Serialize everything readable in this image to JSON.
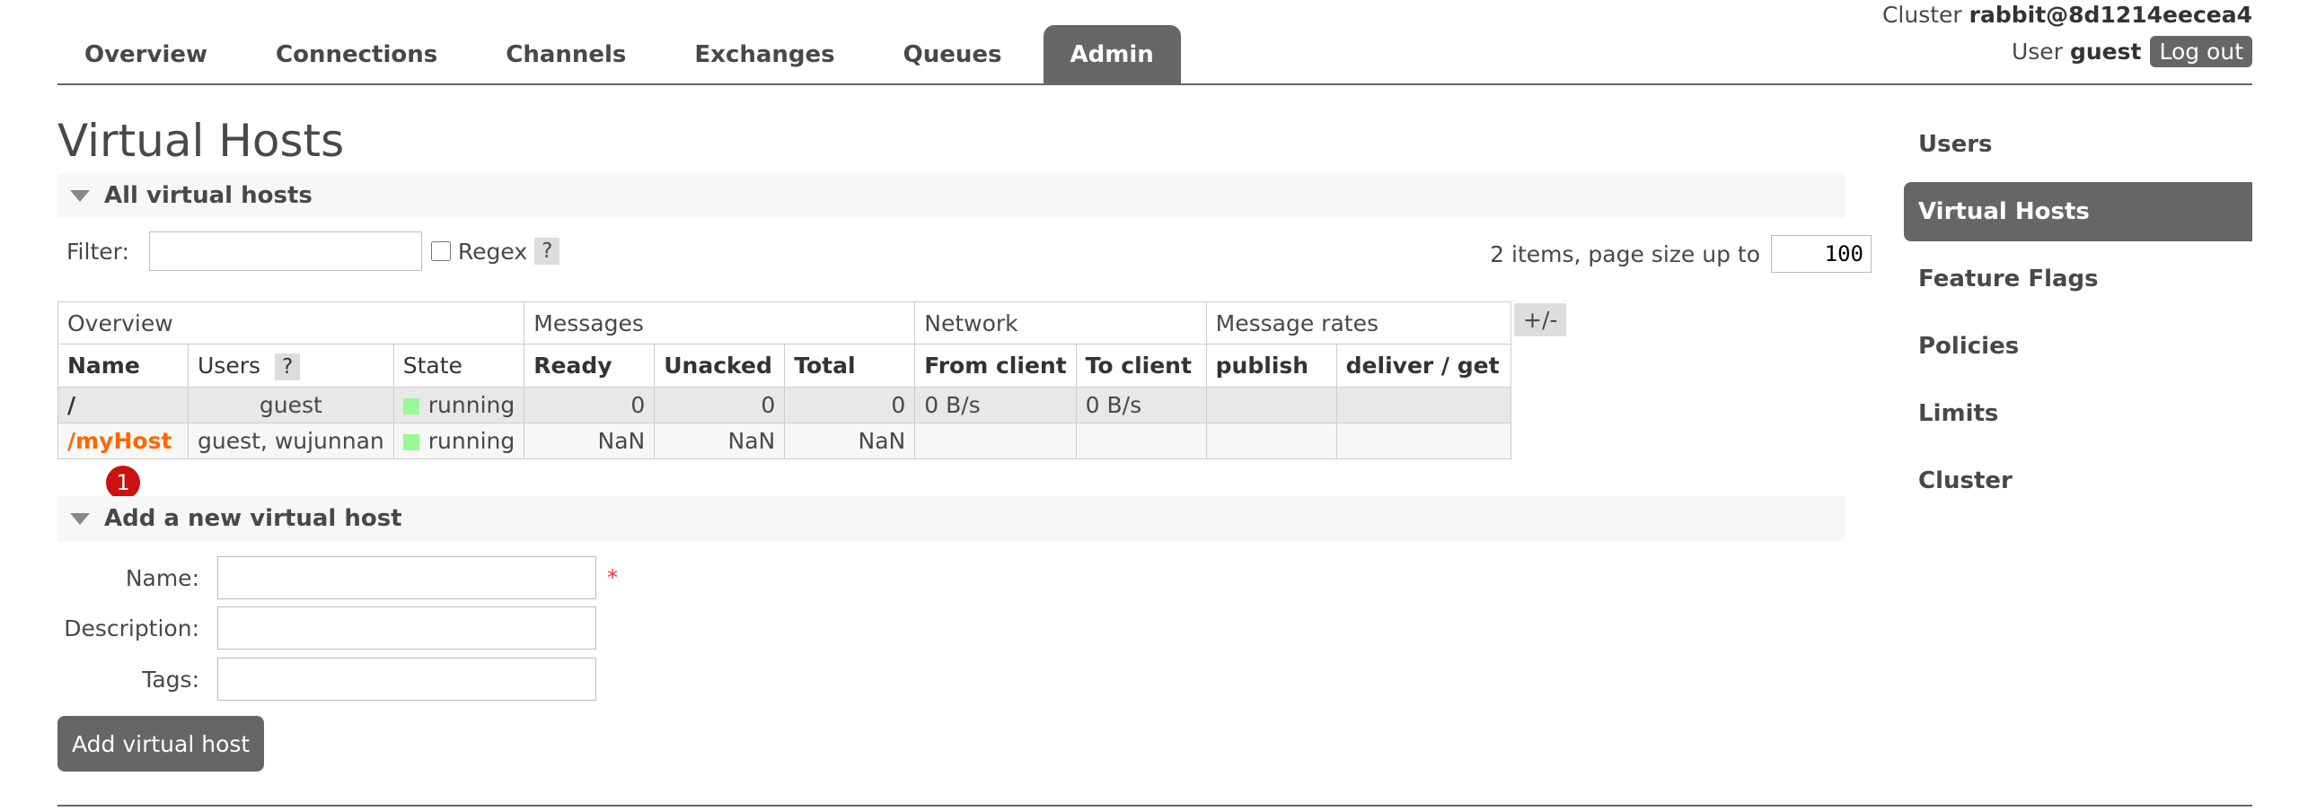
{
  "header": {
    "cluster_label": "Cluster",
    "cluster_name": "rabbit@8d1214eecea4",
    "user_label": "User",
    "user_name": "guest",
    "logout": "Log out"
  },
  "tabs": [
    {
      "label": "Overview"
    },
    {
      "label": "Connections"
    },
    {
      "label": "Channels"
    },
    {
      "label": "Exchanges"
    },
    {
      "label": "Queues"
    },
    {
      "label": "Admin",
      "active": true
    }
  ],
  "page_title": "Virtual Hosts",
  "all_vhosts": {
    "section_title": "All virtual hosts",
    "filter_label": "Filter:",
    "filter_value": "",
    "regex_label": "Regex",
    "help": "?",
    "paging_text": "2 items, page size up to",
    "page_size": "100",
    "toggle_columns": "+/-",
    "groups": [
      "Overview",
      "Messages",
      "Network",
      "Message rates"
    ],
    "columns": [
      "Name",
      "Users",
      "State",
      "Ready",
      "Unacked",
      "Total",
      "From client",
      "To client",
      "publish",
      "deliver / get"
    ],
    "users_help": "?",
    "rows": [
      {
        "name": "/",
        "users": "guest",
        "state": "running",
        "ready": "0",
        "unacked": "0",
        "total": "0",
        "from_client": "0 B/s",
        "to_client": "0 B/s",
        "publish": "",
        "deliver_get": ""
      },
      {
        "name": "/myHost",
        "users": "guest, wujunnan",
        "state": "running",
        "ready": "NaN",
        "unacked": "NaN",
        "total": "NaN",
        "from_client": "",
        "to_client": "",
        "publish": "",
        "deliver_get": ""
      }
    ],
    "badge": "1"
  },
  "add_vhost": {
    "section_title": "Add a new virtual host",
    "name_label": "Name:",
    "required_mark": "*",
    "description_label": "Description:",
    "tags_label": "Tags:",
    "name_value": "",
    "description_value": "",
    "tags_value": "",
    "submit": "Add virtual host"
  },
  "sidebar": {
    "items": [
      {
        "label": "Users"
      },
      {
        "label": "Virtual Hosts",
        "active": true
      },
      {
        "label": "Feature Flags"
      },
      {
        "label": "Policies"
      },
      {
        "label": "Limits"
      },
      {
        "label": "Cluster"
      }
    ]
  },
  "colors": {
    "accent_gray": "#666666",
    "link_orange": "#ff6600",
    "running_green": "#98f898",
    "badge_red": "#cc1111"
  }
}
